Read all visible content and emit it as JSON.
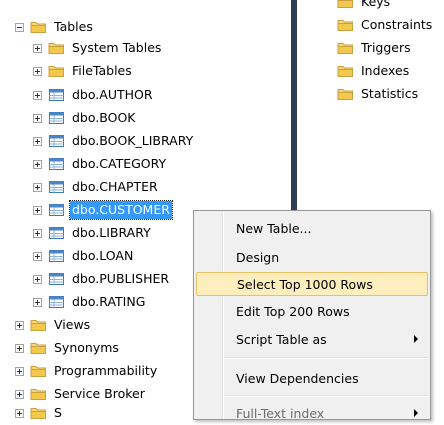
{
  "tree": {
    "tables": "Tables",
    "system_tables": "System Tables",
    "file_tables": "FileTables",
    "t1": "dbo.AUTHOR",
    "t2": "dbo.BOOK",
    "t3": "dbo.BOOK_LIBRARY",
    "t4": "dbo.CATEGORY",
    "t5": "dbo.CHAPTER",
    "t6": "dbo.CUSTOMER",
    "t7": "dbo.LIBRARY",
    "t8": "dbo.LOAN",
    "t9": "dbo.PUBLISHER",
    "t10": "dbo.RATING",
    "views": "Views",
    "synonyms": "Synonyms",
    "programmability": "Programmability",
    "service_broker": "Service Broker",
    "storage_partial": "S"
  },
  "right": {
    "keys_partial": "Keys",
    "constraints": "Constraints",
    "triggers": "Triggers",
    "indexes": "Indexes",
    "statistics": "Statistics"
  },
  "menu": {
    "new_table": "New Table...",
    "design": "Design",
    "select_top": "Select Top 1000 Rows",
    "edit_top": "Edit Top 200 Rows",
    "script_table": "Script Table as",
    "view_dependencies": "View Dependencies",
    "full_text": "Full-Text index"
  },
  "colors": {
    "selection": "#3399ff",
    "menu_highlight": "#fcefbd",
    "folder": "#e8c05c",
    "table_icon": "#4a86c8"
  }
}
